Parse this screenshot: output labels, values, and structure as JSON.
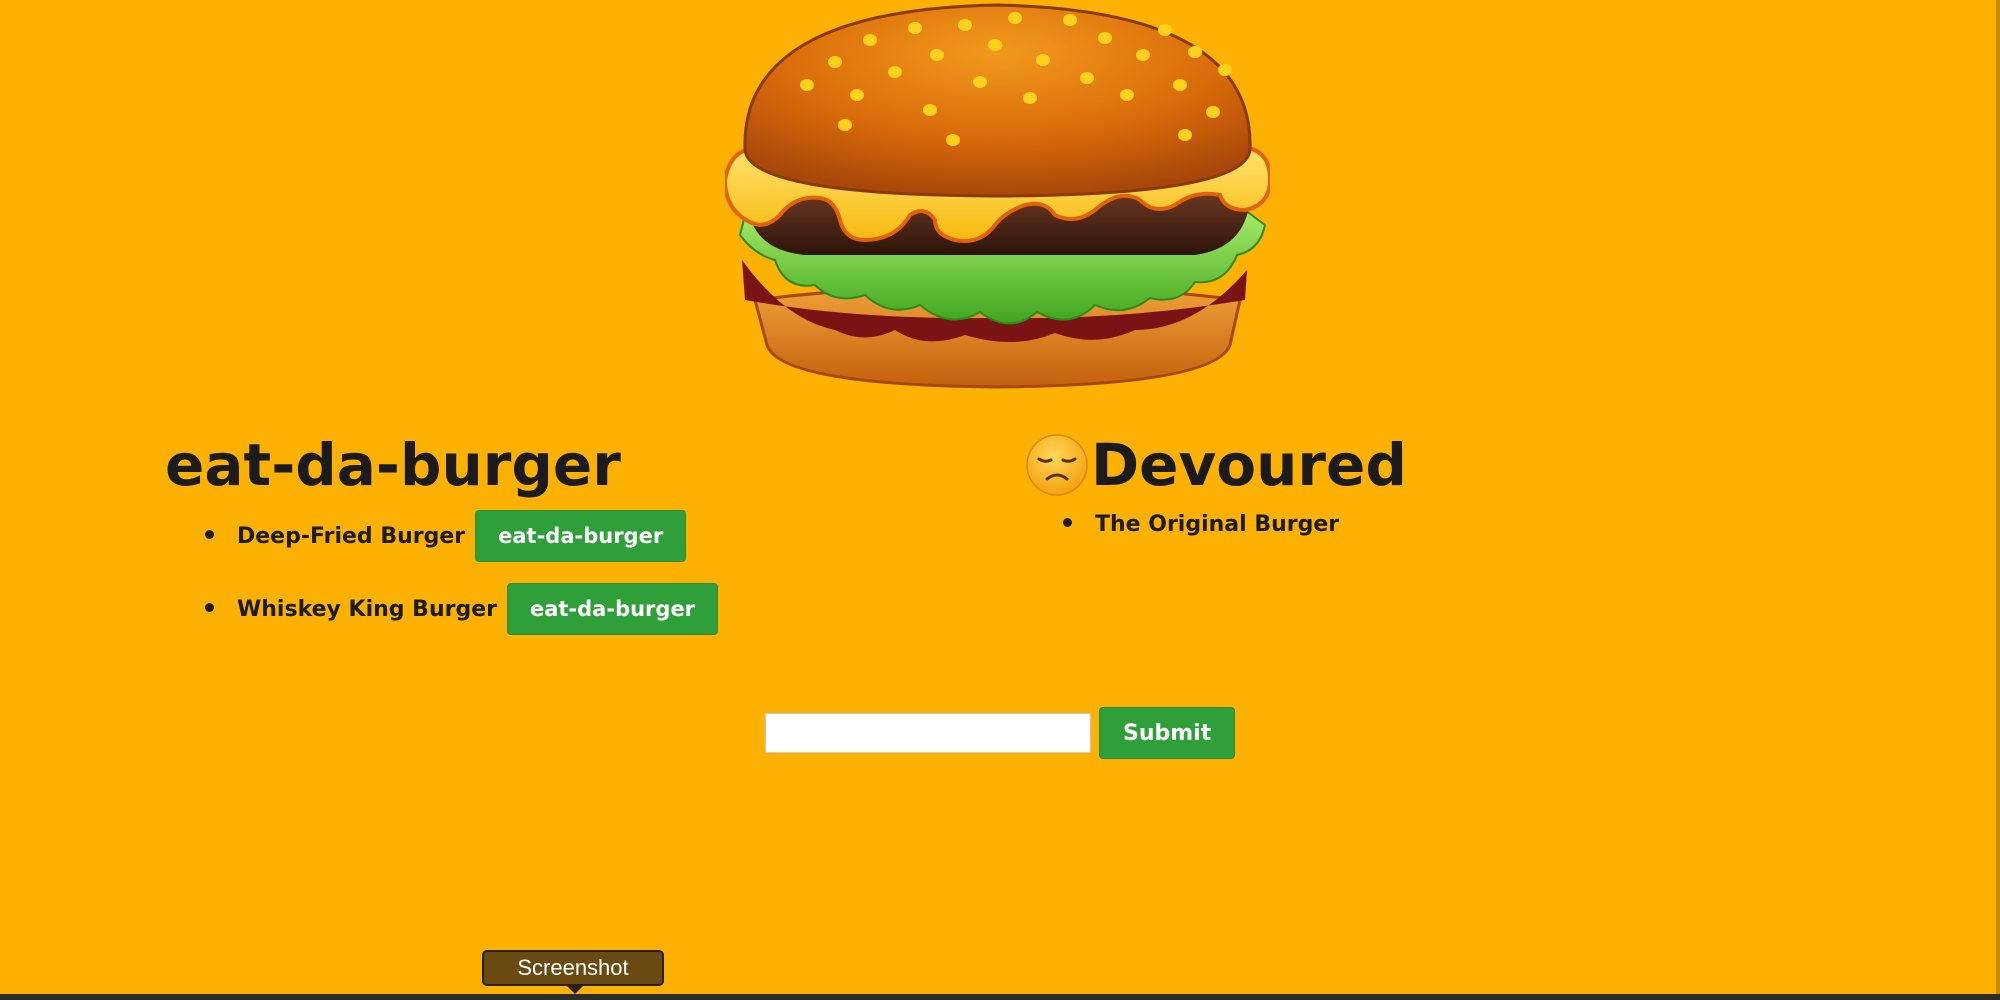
{
  "left_column": {
    "title": "eat-da-burger",
    "burgers": [
      {
        "name": "Deep-Fried Burger",
        "button_label": "eat-da-burger"
      },
      {
        "name": "Whiskey King Burger",
        "button_label": "eat-da-burger"
      }
    ]
  },
  "right_column": {
    "title": "Devoured",
    "title_icon": "disappointed-face-icon",
    "burgers": [
      {
        "name": "The Original Burger"
      }
    ]
  },
  "form": {
    "input_value": "",
    "input_placeholder": "",
    "submit_label": "Submit"
  },
  "tooltip": {
    "label": "Screenshot"
  },
  "hero": {
    "icon": "hamburger-icon"
  },
  "colors": {
    "background": "#fdb103",
    "button": "#2f9f3a",
    "text": "#1b1b1b"
  }
}
